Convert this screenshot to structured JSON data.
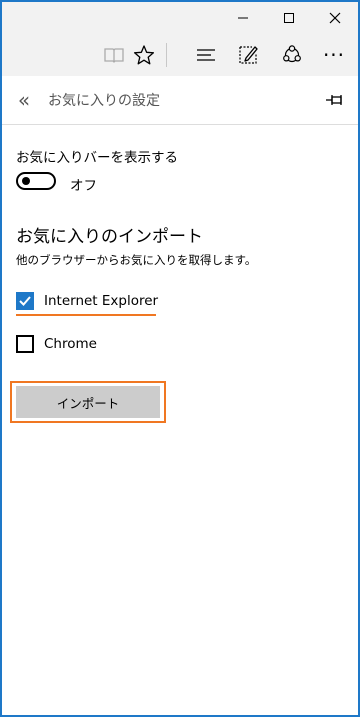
{
  "window": {
    "controls": [
      {
        "name": "minimize-button",
        "icon": "minimize-icon"
      },
      {
        "name": "maximize-button",
        "icon": "maximize-icon"
      },
      {
        "name": "close-button",
        "icon": "close-icon"
      }
    ]
  },
  "toolbar": {
    "items": [
      {
        "name": "reading-view-button",
        "icon": "book-icon",
        "enabled": false
      },
      {
        "name": "favorite-star-button",
        "icon": "star-icon",
        "enabled": true
      },
      {
        "name": "hub-button",
        "icon": "hub-lines-icon",
        "enabled": true
      },
      {
        "name": "web-note-button",
        "icon": "pen-note-icon",
        "enabled": true
      },
      {
        "name": "share-button",
        "icon": "share-icon",
        "enabled": true
      },
      {
        "name": "more-button",
        "icon": "more-dots-icon",
        "label": "···",
        "enabled": true
      }
    ]
  },
  "panel": {
    "back_glyph": "«",
    "title": "お気に入りの設定",
    "pin_icon": "pin-icon"
  },
  "settings": {
    "favorites_bar_label": "お気に入りバーを表示する",
    "favorites_bar_state": "オフ",
    "favorites_bar_on": false,
    "import_title": "お気に入りのインポート",
    "import_description": "他のブラウザーからお気に入りを取得します。",
    "browsers": [
      {
        "label": "Internet Explorer",
        "checked": true
      },
      {
        "label": "Chrome",
        "checked": false
      }
    ],
    "import_button_label": "インポート"
  },
  "colors": {
    "accent": "#1e78c8",
    "highlight": "#f07722",
    "chrome_background": "#f2f2f2",
    "button_background": "#cccccc"
  }
}
